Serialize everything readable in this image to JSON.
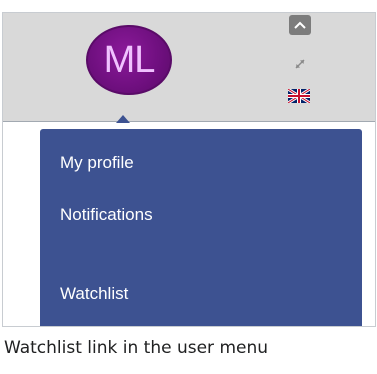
{
  "user_menu": {
    "avatar_initials": "ML",
    "items": [
      {
        "label": "My profile"
      },
      {
        "label": "Notifications"
      },
      {
        "label": "Watchlist"
      }
    ]
  },
  "toolbar": {
    "collapse_icon": "chevron-up-icon",
    "expand_icon": "expand-arrows-icon",
    "language_icon": "uk-flag-icon"
  },
  "caption": "Watchlist link in the user menu",
  "colors": {
    "header_bg": "#d9d9d9",
    "menu_bg": "#3d5291",
    "avatar_bg": "#6e0f7e",
    "avatar_text": "#f0c2ff"
  }
}
